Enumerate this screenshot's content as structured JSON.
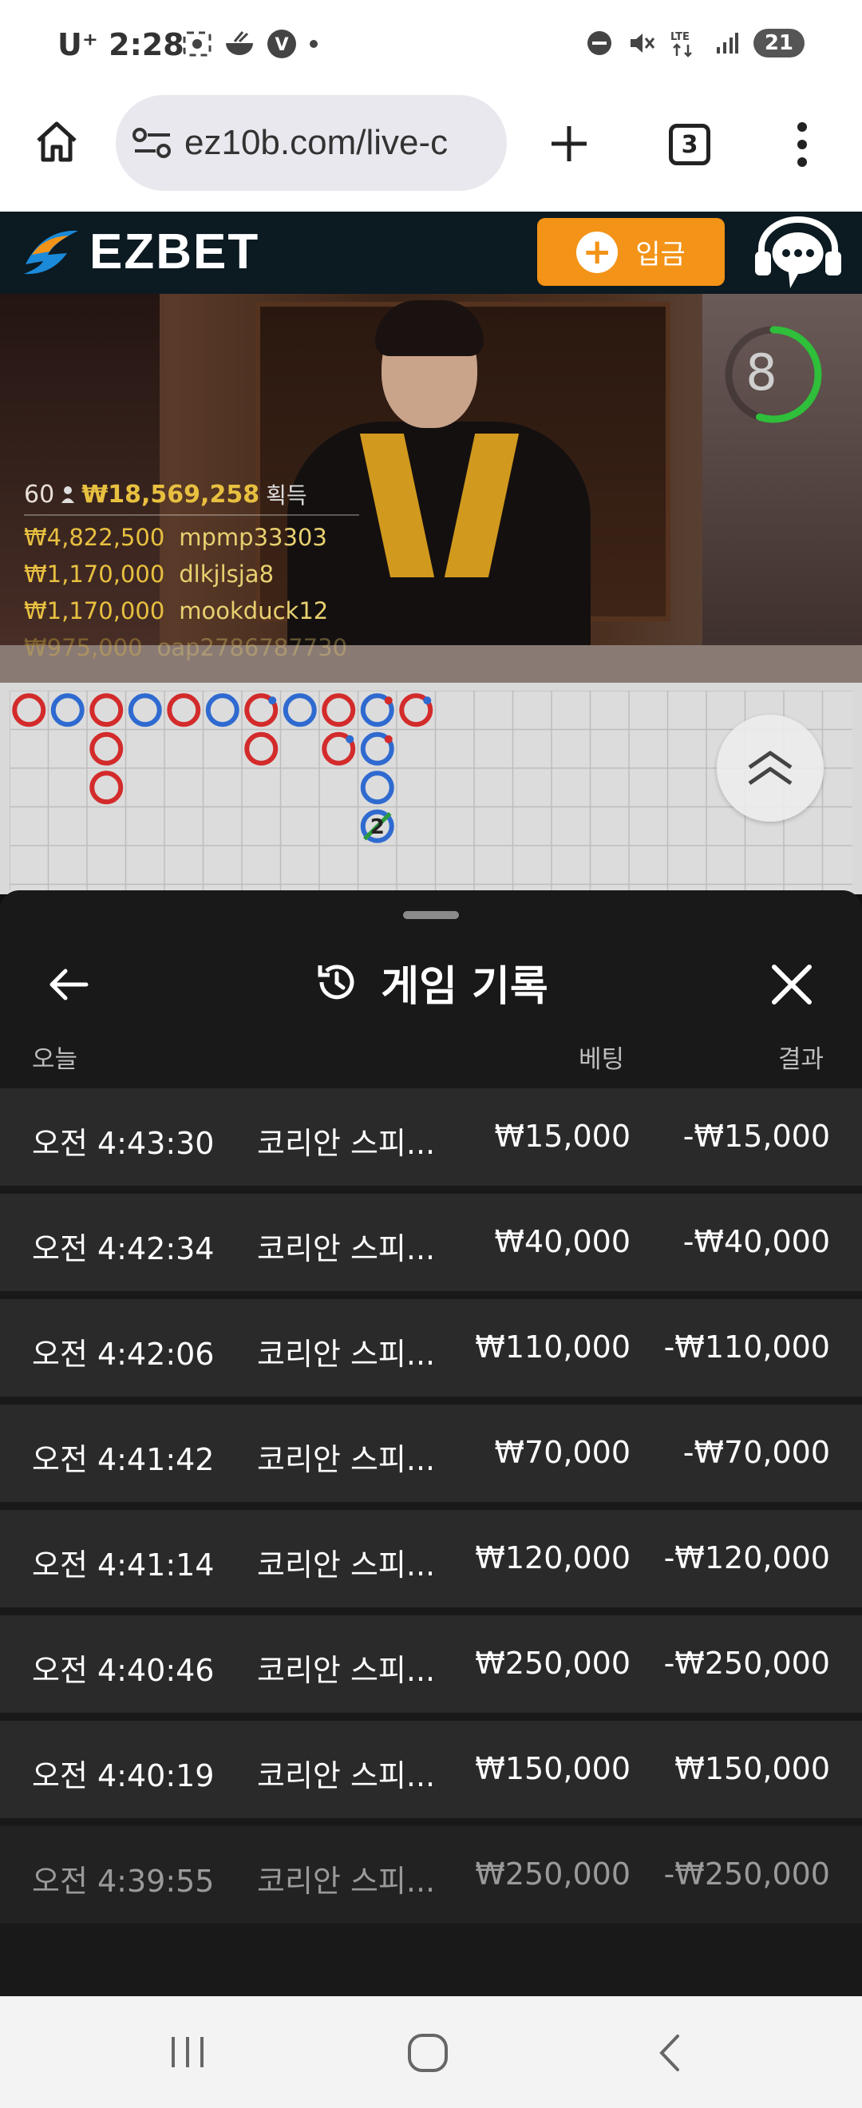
{
  "status_bar": {
    "carrier": "U⁺ 2:28",
    "battery": "21"
  },
  "browser": {
    "url": "ez10b.com/live-c",
    "tab_count": "3"
  },
  "site": {
    "logo": "EZBET",
    "deposit_label": "입금"
  },
  "video": {
    "timer": "8",
    "timer_progress": 0.55,
    "winners_header": {
      "count": "60",
      "amount": "₩18,569,258",
      "label": "획득"
    },
    "winners": [
      {
        "amount": "₩4,822,500",
        "user": "mpmp33303"
      },
      {
        "amount": "₩1,170,000",
        "user": "dlkjlsja8"
      },
      {
        "amount": "₩1,170,000",
        "user": "mookduck12"
      },
      {
        "amount": "₩975,000",
        "user": "oap2786787730"
      }
    ]
  },
  "road": {
    "colors": {
      "banker": "#d32b2b",
      "player": "#2f6ad0",
      "tie": "#2a9a3a"
    },
    "beads": [
      {
        "col": 0,
        "row": 0,
        "side": "banker"
      },
      {
        "col": 1,
        "row": 0,
        "side": "player"
      },
      {
        "col": 2,
        "row": 0,
        "side": "banker"
      },
      {
        "col": 2,
        "row": 1,
        "side": "banker"
      },
      {
        "col": 2,
        "row": 2,
        "side": "banker"
      },
      {
        "col": 3,
        "row": 0,
        "side": "player"
      },
      {
        "col": 4,
        "row": 0,
        "side": "banker"
      },
      {
        "col": 5,
        "row": 0,
        "side": "player"
      },
      {
        "col": 6,
        "row": 0,
        "side": "banker",
        "dot": true
      },
      {
        "col": 6,
        "row": 1,
        "side": "banker"
      },
      {
        "col": 7,
        "row": 0,
        "side": "player"
      },
      {
        "col": 8,
        "row": 0,
        "side": "banker"
      },
      {
        "col": 8,
        "row": 1,
        "side": "banker",
        "dot": true
      },
      {
        "col": 9,
        "row": 0,
        "side": "player",
        "dot": true
      },
      {
        "col": 9,
        "row": 1,
        "side": "player",
        "dot": true
      },
      {
        "col": 9,
        "row": 2,
        "side": "player"
      },
      {
        "col": 9,
        "row": 3,
        "side": "player",
        "tie": true,
        "label": "2"
      },
      {
        "col": 10,
        "row": 0,
        "side": "banker",
        "dot": true
      }
    ]
  },
  "history": {
    "title": "게임 기록",
    "columns": {
      "date": "오늘",
      "bet": "베팅",
      "result": "결과"
    },
    "rows": [
      {
        "time": "오전 4:43:30",
        "game": "코리안 스피...",
        "bet": "₩15,000",
        "result": "-₩15,000"
      },
      {
        "time": "오전 4:42:34",
        "game": "코리안 스피...",
        "bet": "₩40,000",
        "result": "-₩40,000"
      },
      {
        "time": "오전 4:42:06",
        "game": "코리안 스피...",
        "bet": "₩110,000",
        "result": "-₩110,000"
      },
      {
        "time": "오전 4:41:42",
        "game": "코리안 스피...",
        "bet": "₩70,000",
        "result": "-₩70,000"
      },
      {
        "time": "오전 4:41:14",
        "game": "코리안 스피...",
        "bet": "₩120,000",
        "result": "-₩120,000"
      },
      {
        "time": "오전 4:40:46",
        "game": "코리안 스피...",
        "bet": "₩250,000",
        "result": "-₩250,000"
      },
      {
        "time": "오전 4:40:19",
        "game": "코리안 스피...",
        "bet": "₩150,000",
        "result": "₩150,000"
      },
      {
        "time": "오전 4:39:55",
        "game": "코리안 스피...",
        "bet": "₩250,000",
        "result": "-₩250,000"
      }
    ]
  }
}
